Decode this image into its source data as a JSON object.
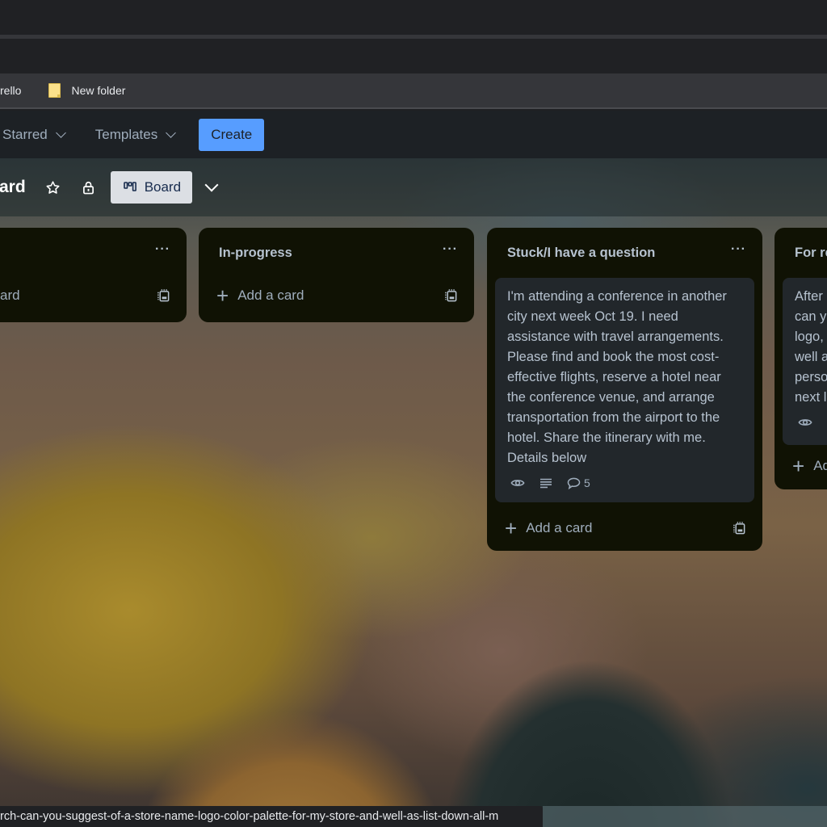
{
  "bookmarks": [
    {
      "label": "rello",
      "icon": "trello-favicon"
    },
    {
      "label": "New folder",
      "icon": "folder-icon"
    }
  ],
  "header": {
    "menus": [
      {
        "label": "Starred"
      },
      {
        "label": "Templates"
      }
    ],
    "create_label": "Create",
    "accent": "#579dff"
  },
  "board": {
    "title": "ard",
    "view_label": "Board"
  },
  "lists": [
    {
      "title": "",
      "add_label": "ard",
      "cards": []
    },
    {
      "title": "In-progress",
      "add_label": "Add a card",
      "cards": []
    },
    {
      "title": "Stuck/I have a question",
      "add_label": "Add a card",
      "cards": [
        {
          "text": "I'm attending a conference in another\ncity next week Oct 19. I need\nassistance with travel arrangements.\nPlease find and book the most cost-\neffective flights, reserve a hotel near\nthe conference venue, and arrange\ntransportation from the airport to the\nhotel. Share the itinerary with me.\nDetails below",
          "badges": {
            "watch": true,
            "description": true,
            "comments": "5"
          }
        }
      ]
    },
    {
      "title": "For re",
      "add_label": "Ad",
      "cards": [
        {
          "text": "After\ncan y\nlogo,\nwell a\nperso\nnext l",
          "badges": {
            "watch": true
          }
        }
      ]
    }
  ],
  "statusbar": {
    "url": "rch-can-you-suggest-of-a-store-name-logo-color-palette-for-my-store-and-well-as-list-down-all-m"
  }
}
